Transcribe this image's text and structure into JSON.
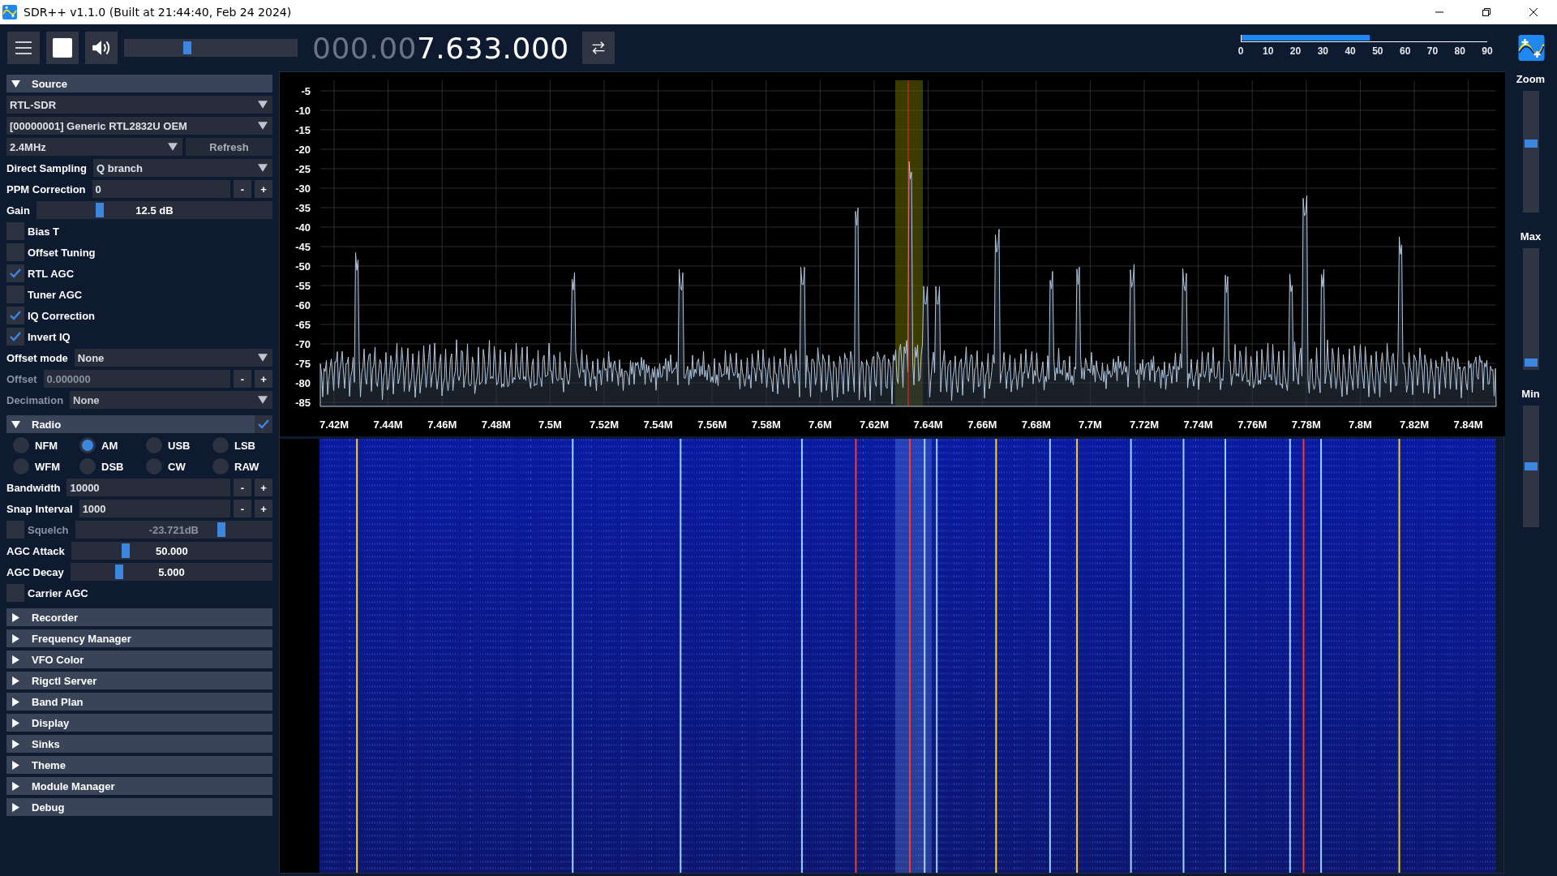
{
  "window": {
    "title": "SDR++ v1.1.0 (Built at 21:44:40, Feb 24 2024)"
  },
  "toolbar": {
    "volume": {
      "level": 0.36
    },
    "frequency": {
      "dim": "000.00",
      "bright": "7.633.000"
    },
    "snr_meter": {
      "level": 0.52,
      "ticks": [
        "0",
        "10",
        "20",
        "30",
        "40",
        "50",
        "60",
        "70",
        "80",
        "90"
      ]
    }
  },
  "source": {
    "title": "Source",
    "expanded": true,
    "items": [
      {
        "kind": "select",
        "value": "RTL-SDR",
        "disabled": false
      },
      {
        "kind": "select",
        "value": "[00000001] Generic RTL2832U OEM",
        "disabled": false
      },
      {
        "kind": "select_button",
        "value": "2.4MHz",
        "button": "Refresh",
        "disabled": false
      },
      {
        "kind": "select",
        "label": "Direct Sampling",
        "value": "Q branch",
        "disabled": false
      },
      {
        "kind": "stepper",
        "label": "PPM Correction",
        "value": "0",
        "minus": "-",
        "plus": "+",
        "disabled": false
      },
      {
        "kind": "slider",
        "label": "Gain",
        "value": "12.5 dB",
        "level": 0.26,
        "disabled": false
      },
      {
        "kind": "checkbox",
        "label": "Bias T",
        "checked": false,
        "disabled": false
      },
      {
        "kind": "checkbox",
        "label": "Offset Tuning",
        "checked": false,
        "disabled": false
      },
      {
        "kind": "checkbox",
        "label": "RTL AGC",
        "checked": true,
        "disabled": false
      },
      {
        "kind": "checkbox",
        "label": "Tuner AGC",
        "checked": false,
        "disabled": false
      },
      {
        "kind": "checkbox",
        "label": "IQ Correction",
        "checked": true,
        "disabled": false
      },
      {
        "kind": "checkbox",
        "label": "Invert IQ",
        "checked": true,
        "disabled": false
      },
      {
        "kind": "select",
        "label": "Offset mode",
        "value": "None",
        "disabled": false
      },
      {
        "kind": "stepper",
        "label": "Offset",
        "value": "0.000000",
        "minus": "-",
        "plus": "+",
        "disabled": true
      },
      {
        "kind": "select",
        "label": "Decimation",
        "value": "None",
        "disabled": true
      }
    ]
  },
  "radio": {
    "title": "Radio",
    "expanded": true,
    "enabled": true,
    "modes": [
      {
        "label": "NFM",
        "selected": false
      },
      {
        "label": "AM",
        "selected": true
      },
      {
        "label": "USB",
        "selected": false
      },
      {
        "label": "LSB",
        "selected": false
      },
      {
        "label": "WFM",
        "selected": false
      },
      {
        "label": "DSB",
        "selected": false
      },
      {
        "label": "CW",
        "selected": false
      },
      {
        "label": "RAW",
        "selected": false
      }
    ],
    "items": [
      {
        "kind": "stepper",
        "label": "Bandwidth",
        "value": "10000",
        "minus": "-",
        "plus": "+",
        "disabled": false
      },
      {
        "kind": "stepper",
        "label": "Snap Interval",
        "value": "1000",
        "minus": "-",
        "plus": "+",
        "disabled": false
      },
      {
        "kind": "check_slider",
        "label": "Squelch",
        "checked": false,
        "value": "-23.721dB",
        "level": 0.75,
        "disabled": true
      },
      {
        "kind": "slider",
        "label": "AGC Attack",
        "value": "50.000",
        "level": 0.26,
        "disabled": false
      },
      {
        "kind": "slider",
        "label": "AGC Decay",
        "value": "5.000",
        "level": 0.23,
        "disabled": false
      },
      {
        "kind": "checkbox",
        "label": "Carrier AGC",
        "checked": false,
        "disabled": false
      }
    ]
  },
  "collapsed_sections": [
    {
      "title": "Recorder",
      "expanded": false
    },
    {
      "title": "Frequency Manager",
      "expanded": false
    },
    {
      "title": "VFO Color",
      "expanded": false
    },
    {
      "title": "Rigctl Server",
      "expanded": false
    },
    {
      "title": "Band Plan",
      "expanded": false
    },
    {
      "title": "Display",
      "expanded": false
    },
    {
      "title": "Sinks",
      "expanded": false
    },
    {
      "title": "Theme",
      "expanded": false
    },
    {
      "title": "Module Manager",
      "expanded": false
    },
    {
      "title": "Debug",
      "expanded": false
    }
  ],
  "spectrum": {
    "y_labels": [
      "-5",
      "-10",
      "-15",
      "-20",
      "-25",
      "-30",
      "-35",
      "-40",
      "-45",
      "-50",
      "-55",
      "-60",
      "-65",
      "-70",
      "-75",
      "-80",
      "-85"
    ],
    "x_labels": [
      "7.42M",
      "7.44M",
      "7.46M",
      "7.48M",
      "7.5M",
      "7.52M",
      "7.54M",
      "7.56M",
      "7.58M",
      "7.6M",
      "7.62M",
      "7.64M",
      "7.66M",
      "7.68M",
      "7.7M",
      "7.72M",
      "7.74M",
      "7.76M",
      "7.78M",
      "7.8M",
      "7.82M",
      "7.84M"
    ]
  },
  "side_sliders": [
    {
      "label": "Zoom",
      "level": 0.57
    },
    {
      "label": "Max",
      "level": 0.03
    },
    {
      "label": "Min",
      "level": 0.5
    }
  ]
}
